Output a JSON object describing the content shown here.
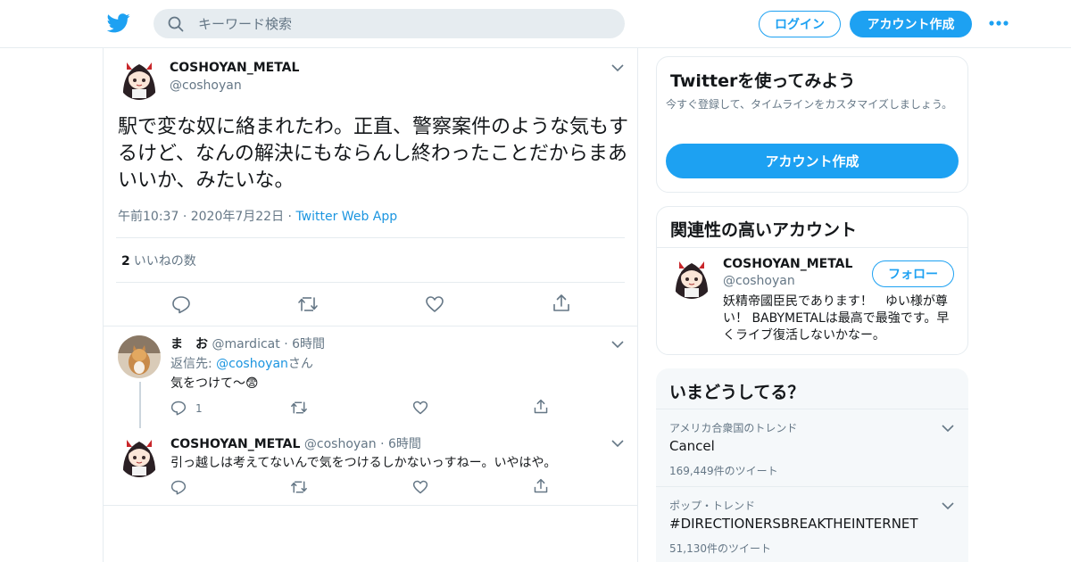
{
  "header": {
    "search_placeholder": "キーワード検索",
    "login_label": "ログイン",
    "signup_label": "アカウント作成"
  },
  "tweet": {
    "author_name": "COSHOYAN_METAL",
    "author_handle": "@coshoyan",
    "text": "駅で変な奴に絡まれたわ。正直、警察案件のような気もするけど、なんの解決にもならんし終わったことだからまあいいか、みたいな。",
    "time": "午前10:37",
    "date": "2020年7月22日",
    "source": "Twitter Web App",
    "like_count": "2",
    "like_label": "いいねの数"
  },
  "replies": [
    {
      "name": "ま　お",
      "handle": "@mardicat",
      "time": "6時間",
      "reply_to_label": "返信先:",
      "reply_to_handle": "@coshoyan",
      "reply_to_suffix": "さん",
      "text": "気をつけて〜😨",
      "reply_count": "1"
    },
    {
      "name": "COSHOYAN_METAL",
      "handle": "@coshoyan",
      "time": "6時間",
      "text": "引っ越しは考えてないんで気をつけるしかないっすねー。いやはや。"
    }
  ],
  "sidebar": {
    "signup_card": {
      "title": "Twitterを使ってみよう",
      "description": "今すぐ登録して、タイムラインをカスタマイズしましょう。",
      "button": "アカウント作成"
    },
    "related": {
      "title": "関連性の高いアカウント",
      "name": "COSHOYAN_METAL",
      "handle": "@coshoyan",
      "follow_label": "フォロー",
      "bio": "妖精帝國臣民であります！　ゆい様が尊い！ BABYMETALは最高で最強です。早くライブ復活しないかなー。"
    },
    "trends": {
      "title": "いまどうしてる？",
      "items": [
        {
          "context": "アメリカ合衆国のトレンド",
          "name": "Cancel",
          "count": "169,449件のツイート"
        },
        {
          "context": "ポップ・トレンド",
          "name": "#DIRECTIONERSBREAKTHEINTERNET",
          "count": "51,130件のツイート"
        }
      ]
    }
  },
  "colors": {
    "accent": "#1da1f2",
    "link": "#1b95e0",
    "secondary_text": "#657786",
    "border": "#e6ecf0"
  }
}
